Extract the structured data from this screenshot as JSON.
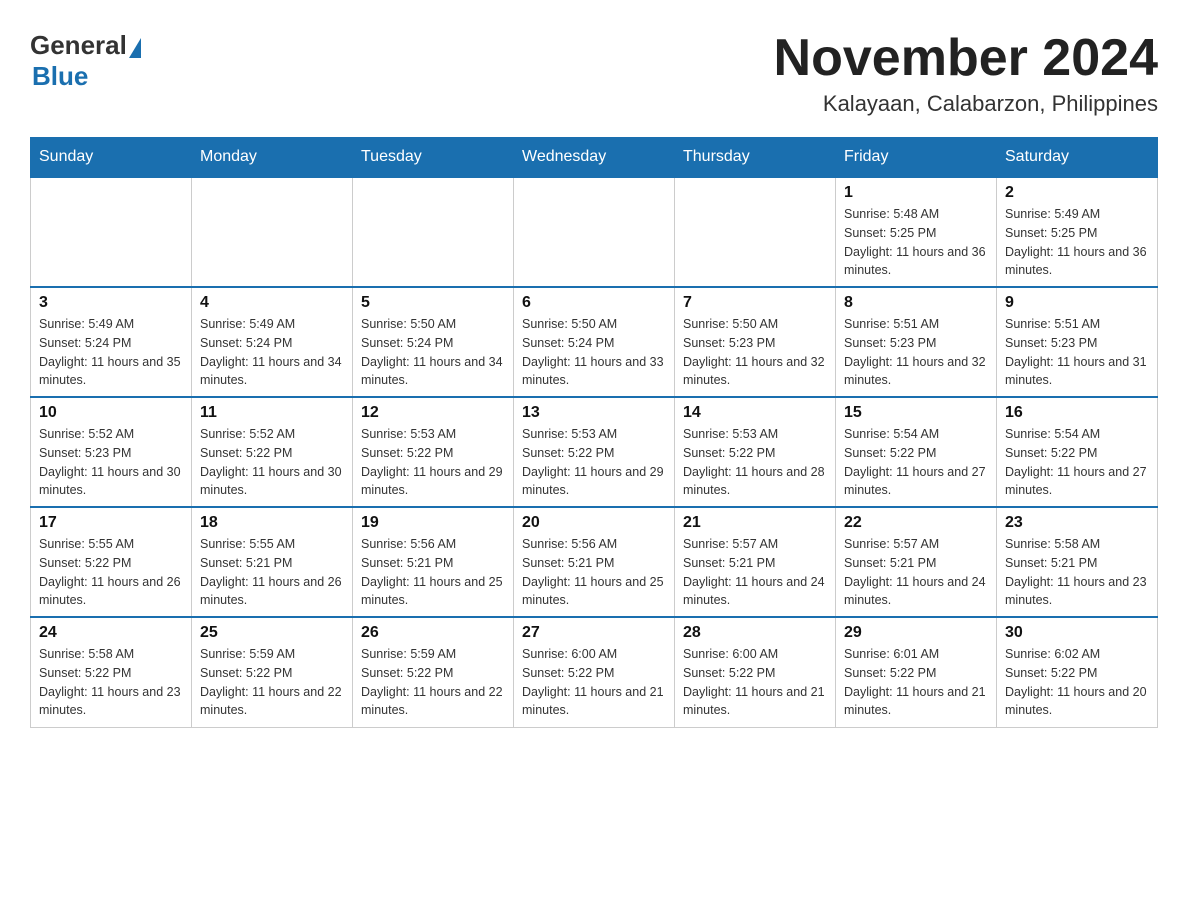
{
  "header": {
    "logo_general": "General",
    "logo_blue": "Blue",
    "month_title": "November 2024",
    "location": "Kalayaan, Calabarzon, Philippines"
  },
  "days_of_week": [
    "Sunday",
    "Monday",
    "Tuesday",
    "Wednesday",
    "Thursday",
    "Friday",
    "Saturday"
  ],
  "weeks": [
    [
      {
        "day": "",
        "info": ""
      },
      {
        "day": "",
        "info": ""
      },
      {
        "day": "",
        "info": ""
      },
      {
        "day": "",
        "info": ""
      },
      {
        "day": "",
        "info": ""
      },
      {
        "day": "1",
        "info": "Sunrise: 5:48 AM\nSunset: 5:25 PM\nDaylight: 11 hours and 36 minutes."
      },
      {
        "day": "2",
        "info": "Sunrise: 5:49 AM\nSunset: 5:25 PM\nDaylight: 11 hours and 36 minutes."
      }
    ],
    [
      {
        "day": "3",
        "info": "Sunrise: 5:49 AM\nSunset: 5:24 PM\nDaylight: 11 hours and 35 minutes."
      },
      {
        "day": "4",
        "info": "Sunrise: 5:49 AM\nSunset: 5:24 PM\nDaylight: 11 hours and 34 minutes."
      },
      {
        "day": "5",
        "info": "Sunrise: 5:50 AM\nSunset: 5:24 PM\nDaylight: 11 hours and 34 minutes."
      },
      {
        "day": "6",
        "info": "Sunrise: 5:50 AM\nSunset: 5:24 PM\nDaylight: 11 hours and 33 minutes."
      },
      {
        "day": "7",
        "info": "Sunrise: 5:50 AM\nSunset: 5:23 PM\nDaylight: 11 hours and 32 minutes."
      },
      {
        "day": "8",
        "info": "Sunrise: 5:51 AM\nSunset: 5:23 PM\nDaylight: 11 hours and 32 minutes."
      },
      {
        "day": "9",
        "info": "Sunrise: 5:51 AM\nSunset: 5:23 PM\nDaylight: 11 hours and 31 minutes."
      }
    ],
    [
      {
        "day": "10",
        "info": "Sunrise: 5:52 AM\nSunset: 5:23 PM\nDaylight: 11 hours and 30 minutes."
      },
      {
        "day": "11",
        "info": "Sunrise: 5:52 AM\nSunset: 5:22 PM\nDaylight: 11 hours and 30 minutes."
      },
      {
        "day": "12",
        "info": "Sunrise: 5:53 AM\nSunset: 5:22 PM\nDaylight: 11 hours and 29 minutes."
      },
      {
        "day": "13",
        "info": "Sunrise: 5:53 AM\nSunset: 5:22 PM\nDaylight: 11 hours and 29 minutes."
      },
      {
        "day": "14",
        "info": "Sunrise: 5:53 AM\nSunset: 5:22 PM\nDaylight: 11 hours and 28 minutes."
      },
      {
        "day": "15",
        "info": "Sunrise: 5:54 AM\nSunset: 5:22 PM\nDaylight: 11 hours and 27 minutes."
      },
      {
        "day": "16",
        "info": "Sunrise: 5:54 AM\nSunset: 5:22 PM\nDaylight: 11 hours and 27 minutes."
      }
    ],
    [
      {
        "day": "17",
        "info": "Sunrise: 5:55 AM\nSunset: 5:22 PM\nDaylight: 11 hours and 26 minutes."
      },
      {
        "day": "18",
        "info": "Sunrise: 5:55 AM\nSunset: 5:21 PM\nDaylight: 11 hours and 26 minutes."
      },
      {
        "day": "19",
        "info": "Sunrise: 5:56 AM\nSunset: 5:21 PM\nDaylight: 11 hours and 25 minutes."
      },
      {
        "day": "20",
        "info": "Sunrise: 5:56 AM\nSunset: 5:21 PM\nDaylight: 11 hours and 25 minutes."
      },
      {
        "day": "21",
        "info": "Sunrise: 5:57 AM\nSunset: 5:21 PM\nDaylight: 11 hours and 24 minutes."
      },
      {
        "day": "22",
        "info": "Sunrise: 5:57 AM\nSunset: 5:21 PM\nDaylight: 11 hours and 24 minutes."
      },
      {
        "day": "23",
        "info": "Sunrise: 5:58 AM\nSunset: 5:21 PM\nDaylight: 11 hours and 23 minutes."
      }
    ],
    [
      {
        "day": "24",
        "info": "Sunrise: 5:58 AM\nSunset: 5:22 PM\nDaylight: 11 hours and 23 minutes."
      },
      {
        "day": "25",
        "info": "Sunrise: 5:59 AM\nSunset: 5:22 PM\nDaylight: 11 hours and 22 minutes."
      },
      {
        "day": "26",
        "info": "Sunrise: 5:59 AM\nSunset: 5:22 PM\nDaylight: 11 hours and 22 minutes."
      },
      {
        "day": "27",
        "info": "Sunrise: 6:00 AM\nSunset: 5:22 PM\nDaylight: 11 hours and 21 minutes."
      },
      {
        "day": "28",
        "info": "Sunrise: 6:00 AM\nSunset: 5:22 PM\nDaylight: 11 hours and 21 minutes."
      },
      {
        "day": "29",
        "info": "Sunrise: 6:01 AM\nSunset: 5:22 PM\nDaylight: 11 hours and 21 minutes."
      },
      {
        "day": "30",
        "info": "Sunrise: 6:02 AM\nSunset: 5:22 PM\nDaylight: 11 hours and 20 minutes."
      }
    ]
  ]
}
